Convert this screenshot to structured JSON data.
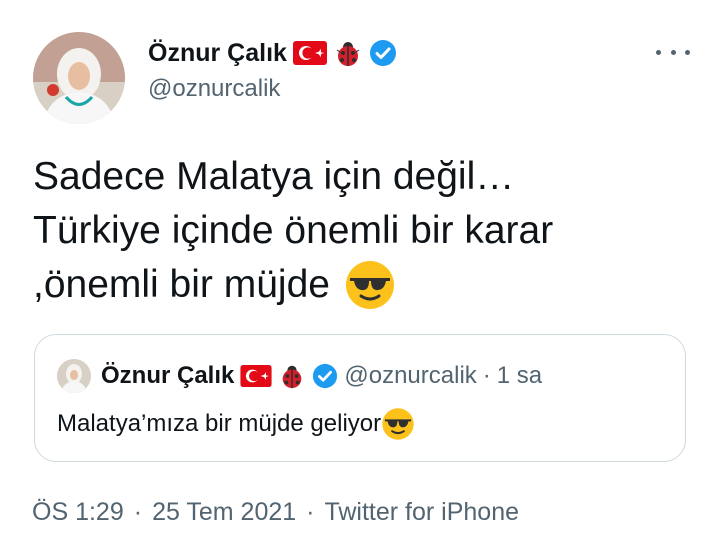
{
  "author": {
    "display_name": "Öznur Çalık",
    "handle": "@oznurcalik"
  },
  "tweet": {
    "lines": [
      "Sadece Malatya için değil…",
      "Türkiye içinde önemli bir karar",
      ",önemli bir müjde"
    ]
  },
  "quoted_tweet": {
    "display_name": "Öznur Çalık",
    "handle": "@oznurcalik",
    "separator": "·",
    "time": "1 sa",
    "text": "Malatya’mıza bir müjde geliyor"
  },
  "footer": {
    "time": "ÖS 1:29",
    "sep1": "·",
    "date": "25 Tem 2021",
    "sep2": "·",
    "source": "Twitter for iPhone"
  },
  "colors": {
    "text": "#0f1419",
    "secondary": "#536471",
    "verified": "#1d9bf0",
    "flag": "#e30a17",
    "border": "#cfd9de"
  },
  "icons": [
    "turkey-flag-icon",
    "ladybug-icon",
    "verified-badge-icon",
    "sunglasses-emoji-icon",
    "more-options-icon"
  ]
}
